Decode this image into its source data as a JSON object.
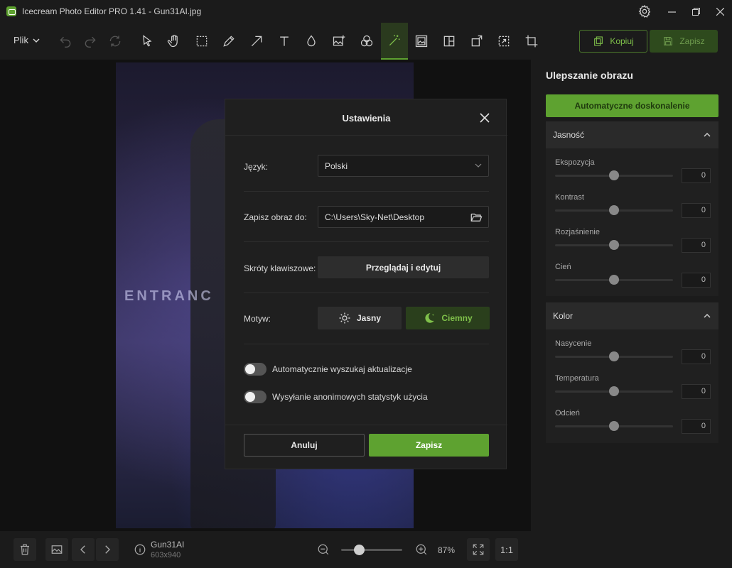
{
  "window": {
    "title": "Icecream Photo Editor PRO 1.41 - Gun31AI.jpg"
  },
  "toolbar": {
    "file_menu": "Plik",
    "copy_label": "Kopiuj",
    "save_label": "Zapisz",
    "tools": [
      "undo-icon",
      "redo-icon",
      "reset-icon",
      "cursor-icon",
      "hand-icon",
      "select-icon",
      "pen-icon",
      "arrow-icon",
      "text-icon",
      "drop-icon",
      "add-image-icon",
      "filters-icon",
      "enhance-icon",
      "frame-icon",
      "collage-icon",
      "rotate-icon",
      "resize-icon",
      "crop-icon"
    ],
    "active_tool": "enhance-icon",
    "accent_color": "#5ea230"
  },
  "image": {
    "name": "Gun31AI",
    "dims": "603x940",
    "sign_text": "ENTRANC"
  },
  "zoom": {
    "value": "87%",
    "one_to_one": "1:1",
    "level": 0.3
  },
  "panel": {
    "title": "Ulepszanie obrazu",
    "auto_label": "Automatyczne doskonalenie",
    "sections": [
      {
        "title": "Jasność",
        "sliders": [
          {
            "label": "Ekspozycja",
            "value": "0"
          },
          {
            "label": "Kontrast",
            "value": "0"
          },
          {
            "label": "Rozjaśnienie",
            "value": "0"
          },
          {
            "label": "Cień",
            "value": "0"
          }
        ]
      },
      {
        "title": "Kolor",
        "sliders": [
          {
            "label": "Nasycenie",
            "value": "0"
          },
          {
            "label": "Temperatura",
            "value": "0"
          },
          {
            "label": "Odcień",
            "value": "0"
          }
        ]
      }
    ]
  },
  "dialog": {
    "title": "Ustawienia",
    "language_label": "Język:",
    "language_value": "Polski",
    "save_path_label": "Zapisz obraz do:",
    "save_path_value": "C:\\Users\\Sky-Net\\Desktop",
    "shortcuts_label": "Skróty klawiszowe:",
    "shortcuts_button": "Przeglądaj i edytuj",
    "theme_label": "Motyw:",
    "theme_light": "Jasny",
    "theme_dark": "Ciemny",
    "selected_theme": "Ciemny",
    "auto_update_label": "Automatycznie wyszukaj aktualizacje",
    "auto_update_on": false,
    "stats_label": "Wysyłanie anonimowych statystyk użycia",
    "stats_on": false,
    "cancel_label": "Anuluj",
    "save_label": "Zapisz"
  }
}
